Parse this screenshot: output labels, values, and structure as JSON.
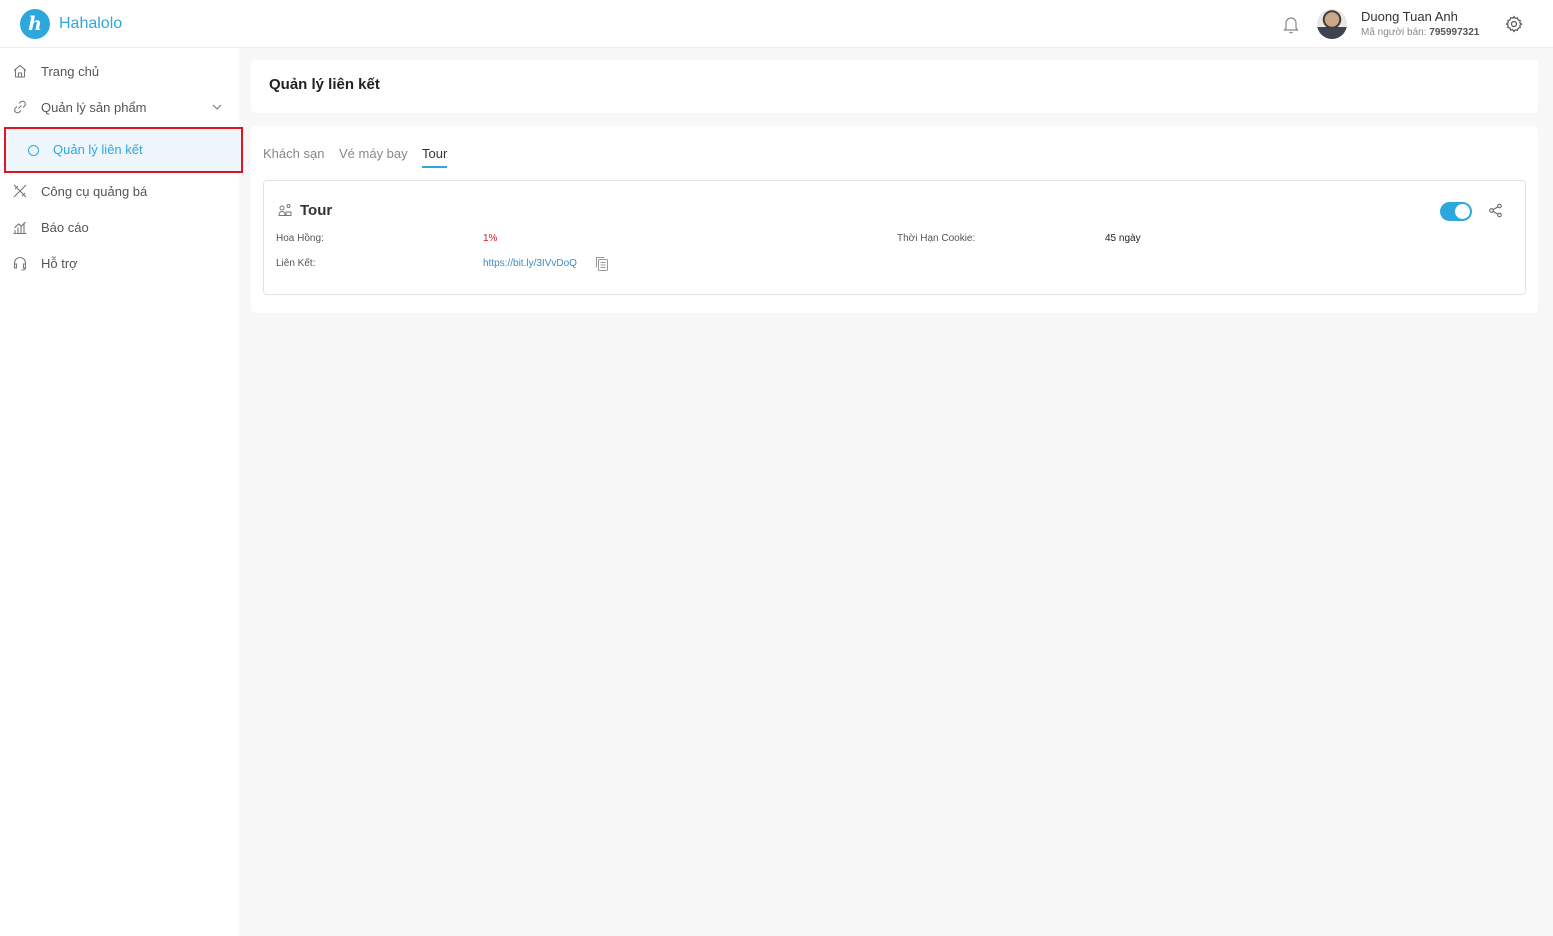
{
  "header": {
    "brand": "Hahalolo",
    "logo_letter": "h",
    "user_name": "Duong Tuan Anh",
    "seller_code_label": "Mã người bán:",
    "seller_code": "795997321",
    "icons": [
      "bell-icon",
      "avatar",
      "gear-icon"
    ]
  },
  "sidebar": {
    "items": [
      {
        "label": "Trang chủ",
        "icon": "home-icon"
      },
      {
        "label": "Quản lý sản phẩm",
        "icon": "link-icon",
        "expandable": true
      },
      {
        "label": "Quản lý liên kết",
        "icon": "circle-icon",
        "active": true
      },
      {
        "label": "Công cụ quảng bá",
        "icon": "tools-icon"
      },
      {
        "label": "Báo cáo",
        "icon": "chart-icon"
      },
      {
        "label": "Hỗ trợ",
        "icon": "headset-icon"
      }
    ]
  },
  "main": {
    "title": "Quản lý liên kết",
    "tabs": [
      {
        "label": "Khách sạn"
      },
      {
        "label": "Vé máy bay"
      },
      {
        "label": "Tour",
        "active": true
      }
    ],
    "affiliate": {
      "title": "Tour",
      "enabled": true,
      "commission_label": "Hoa Hồng:",
      "commission_value": "1%",
      "cookie_label": "Thời Hạn Cookie:",
      "cookie_value": "45 ngày",
      "link_label": "Liên Kết:",
      "link_value": "https://bit.ly/3IVvDoQ"
    }
  },
  "colors": {
    "accent": "#2ea8dc",
    "highlight_border": "#e0141e",
    "commission": "#e0141e",
    "link": "#3a8cc4"
  }
}
